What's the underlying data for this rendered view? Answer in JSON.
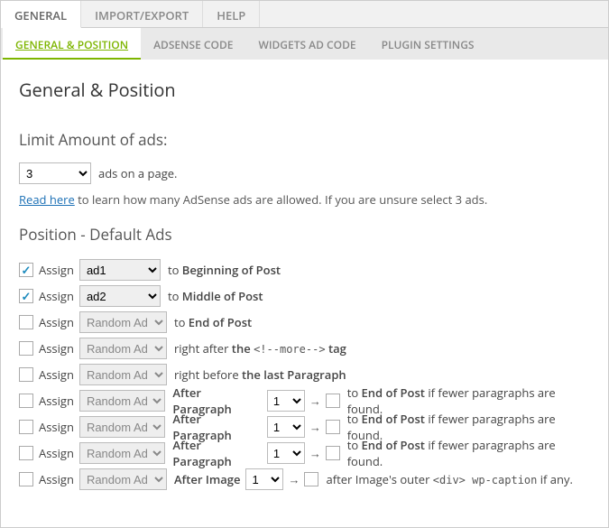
{
  "tabs_top": {
    "general": "GENERAL",
    "import_export": "IMPORT/EXPORT",
    "help": "HELP"
  },
  "tabs_sub": {
    "general_position": "GENERAL & POSITION",
    "adsense_code": "ADSENSE CODE",
    "widgets_ad_code": "WIDGETS AD CODE",
    "plugin_settings": "PLUGIN SETTINGS"
  },
  "section": {
    "title": "General & Position",
    "limit_title": "Limit Amount of ads:",
    "limit_value": "3",
    "limit_suffix": "ads on a page.",
    "learn_link": "Read here",
    "learn_text": " to learn how many AdSense ads are allowed. If you are unsure select 3 ads.",
    "position_title": "Position - Default Ads"
  },
  "labels": {
    "assign": "Assign",
    "to": "to ",
    "right_after": "right after ",
    "the": "the ",
    "more_tag": "<!--more-->",
    "tag_suffix": " tag",
    "right_before": "right before ",
    "last_para": "the last Paragraph",
    "after_para": "After Paragraph",
    "after_image": "After Image",
    "end_of_post": "End of Post",
    "if_fewer": " if fewer paragraphs are found.",
    "after_images_outer": "after Image's outer ",
    "div_caption": "<div> wp-caption",
    "if_any": " if any.",
    "random_ad": "Random Ad",
    "one": "1",
    "arrow": "→"
  },
  "rows": [
    {
      "checked": true,
      "ad": "ad1",
      "disabled": false,
      "pos_bold": "Beginning of Post"
    },
    {
      "checked": true,
      "ad": "ad2",
      "disabled": false,
      "pos_bold": "Middle of Post"
    },
    {
      "checked": false,
      "ad": "Random Ad",
      "disabled": true,
      "pos_bold": "End of Post"
    }
  ]
}
